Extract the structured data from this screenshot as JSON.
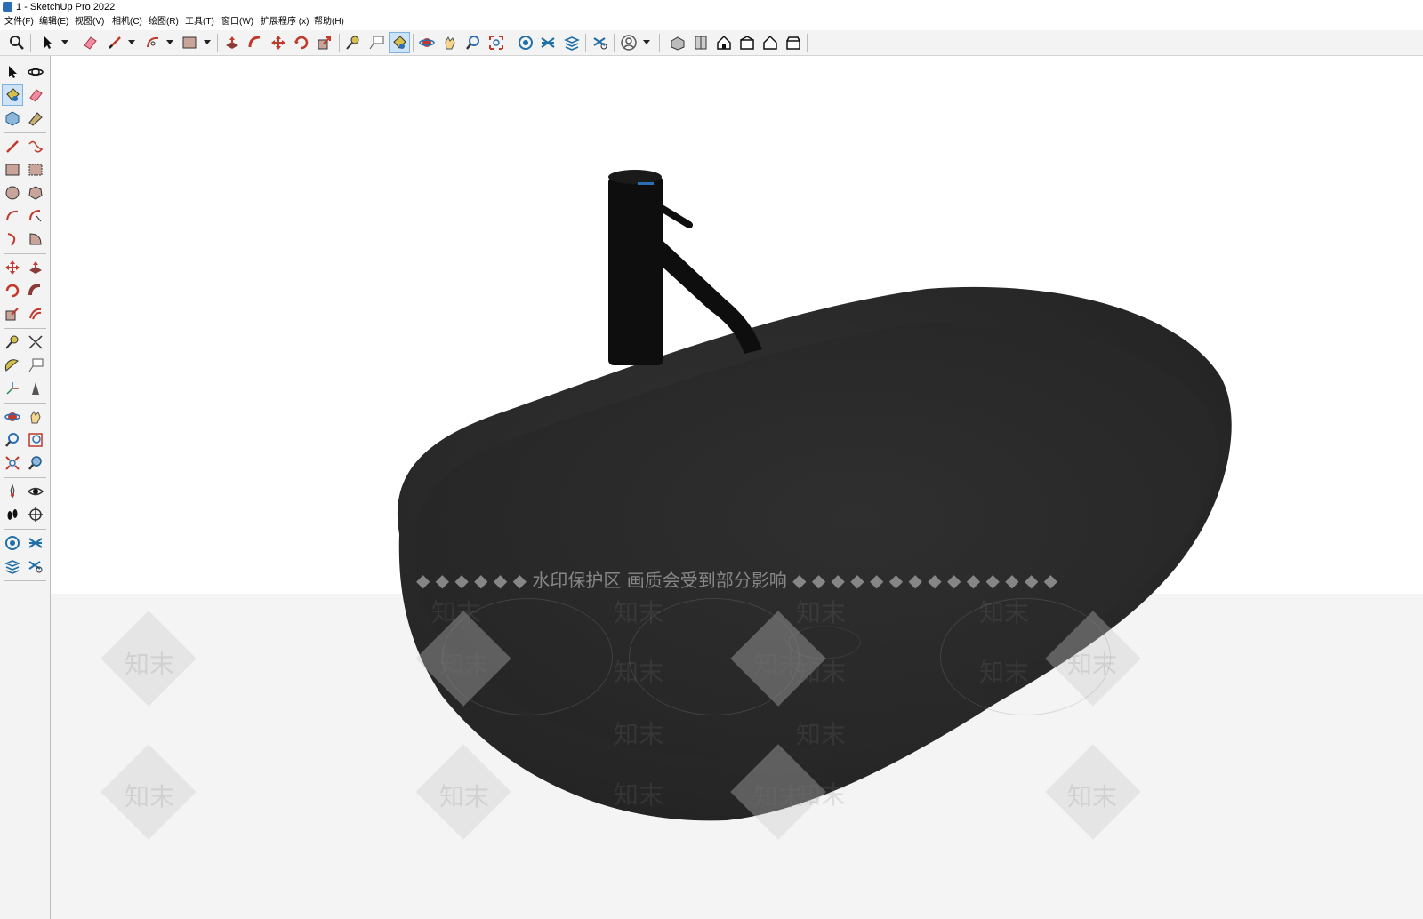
{
  "window": {
    "title": "1 - SketchUp Pro 2022"
  },
  "menu": [
    {
      "label": "文件(F)"
    },
    {
      "label": "编辑(E)"
    },
    {
      "label": "视图(V)"
    },
    {
      "label": "相机(C)"
    },
    {
      "label": "绘图(R)"
    },
    {
      "label": "工具(T)"
    },
    {
      "label": "窗口(W)"
    },
    {
      "label": "扩展程序 (x)"
    },
    {
      "label": "帮助(H)"
    }
  ],
  "toolbar": {
    "tools": [
      "search-icon",
      "select-icon",
      "eraser-icon",
      "pencil-icon",
      "arc-icon",
      "rectangle-icon",
      "push-pull-icon",
      "follow-me-icon",
      "move-icon",
      "rotate-icon",
      "scale-icon",
      "tape-measure-icon",
      "text-icon",
      "paint-bucket-icon",
      "orbit-icon",
      "pan-icon",
      "zoom-icon",
      "zoom-extents-icon",
      "warehouse-icon",
      "extension-warehouse-icon",
      "layout-icon",
      "extensions-icon",
      "account-icon",
      "iso-view-icon",
      "top-view-icon",
      "front-view-icon",
      "right-view-icon",
      "back-view-icon",
      "left-view-icon"
    ],
    "active_tool": "paint-bucket-icon"
  },
  "left_toolbar": {
    "tools": [
      "select-icon",
      "orbit-icon",
      "paint-bucket-icon",
      "eraser-icon",
      "component-icon",
      "tag-icon",
      "pencil-icon",
      "freehand-icon",
      "rectangle-icon",
      "rotated-rectangle-icon",
      "circle-icon",
      "polygon-icon",
      "arc-icon",
      "arc-3pt-icon",
      "pie-icon",
      "arc-2pt-icon",
      "move-icon",
      "push-pull-icon",
      "rotate-icon",
      "follow-me-icon",
      "scale-icon",
      "offset-icon",
      "tape-measure-icon",
      "dimension-icon",
      "protractor-icon",
      "text-icon",
      "axes-icon",
      "3d-text-icon",
      "orbit-icon",
      "pan-icon",
      "zoom-icon",
      "zoom-window-icon",
      "zoom-extents-icon",
      "previous-view-icon",
      "position-camera-icon",
      "look-around-icon",
      "walk-icon",
      "section-plane-icon",
      "warehouse-icon",
      "extension-warehouse-icon",
      "layout-icon",
      "extensions-icon"
    ],
    "active_tool": "paint-bucket-icon"
  },
  "watermark": {
    "notice": "◆ ◆ ◆ ◆ ◆ ◆ 水印保护区  画质会受到部分影响 ◆ ◆ ◆ ◆ ◆ ◆ ◆ ◆ ◆ ◆ ◆ ◆ ◆ ◆",
    "brand": "知末"
  },
  "colors": {
    "basin": "#2d2d2d",
    "basin_rim": "#3a3a3a",
    "faucet": "#0e0e0e",
    "accent": "#cfe3f7"
  }
}
